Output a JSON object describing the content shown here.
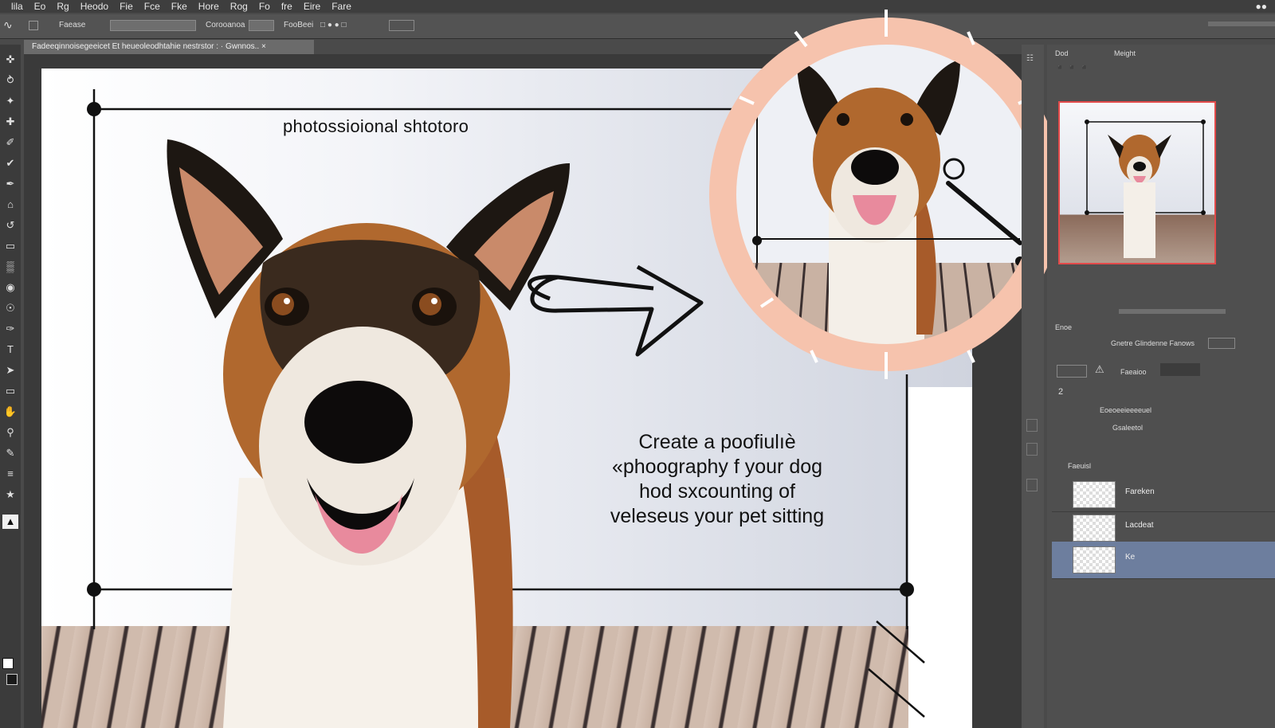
{
  "menu": [
    "lila",
    "Eo",
    "Rg",
    "Heodo",
    "Fie",
    "Fce",
    "Fke",
    "Hore",
    "Rog",
    "Fo",
    "fre",
    "Eire",
    "Fare"
  ],
  "options_bar": {
    "field1": "Faease",
    "field2": "Corooanoa",
    "field3": "FooBeei"
  },
  "document_tab": {
    "label": "Fadeeqinnoisegeeicet Et heueoleodhtahie nestrstor : · Gwnnos.. ×"
  },
  "canvas": {
    "title_text": "photossioional shtotoro",
    "caption_lines": [
      "Create a poofiulıѐ",
      "«phoography f your dog",
      "hod sxcounting of",
      "veleseus your pet sitting"
    ]
  },
  "panels": {
    "navigator": {
      "tab1": "Dod",
      "tab2": "Meight"
    },
    "layers": {
      "header": "Enoe",
      "title": "Gnetre Glindenne Fanows",
      "row2_label": "Faeaioo",
      "row_count": "2",
      "row4_label": "Eoeoeeieeeeuel",
      "row5_label": "Gsaleetol",
      "row6_label": "Faeuisl",
      "items": [
        {
          "name": "Fareken",
          "selected": false
        },
        {
          "name": "Lacdeat",
          "selected": false
        },
        {
          "name": "Ke",
          "selected": true
        }
      ]
    }
  },
  "colors": {
    "ring": "#f6c3ad",
    "selection": "#e34a4a",
    "selected_layer": "#6d7e9e"
  }
}
